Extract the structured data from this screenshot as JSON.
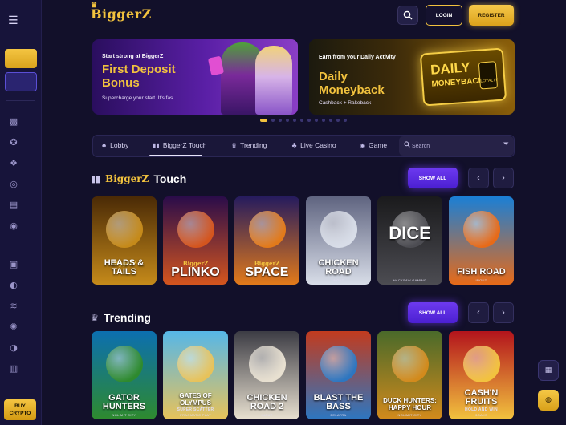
{
  "brand": {
    "logo_text": "BiggerZ"
  },
  "header": {
    "login_label": "LOGIN",
    "register_label": "REGISTER"
  },
  "sidebar": {
    "buy_crypto_line1": "BUY",
    "buy_crypto_line2": "CRYPTO",
    "icons": [
      "dice-icon",
      "bonus-icon",
      "puzzle-icon",
      "roulette-icon",
      "gift-card-icon",
      "chips-icon",
      "gift-icon",
      "coin-icon",
      "layers-icon",
      "medal-icon",
      "sport-icon",
      "receipt-icon"
    ]
  },
  "banners": [
    {
      "eyebrow": "Start strong at BiggerZ",
      "title": "First Deposit Bonus",
      "subtitle": "Supercharge your start. It's fas...",
      "accent": "#5a1fa6"
    },
    {
      "eyebrow": "Earn from your Daily Activity",
      "title": "Daily Moneyback",
      "subtitle": "Cashback + Rakeback",
      "sign_line1": "DAILY",
      "sign_line2": "MONEYBACK",
      "badge": "LOYALTY",
      "accent": "#8a5e0a"
    }
  ],
  "carousel": {
    "dot_count": 12,
    "active_index": 0
  },
  "tabs": [
    {
      "label": "Lobby",
      "icon": "lobby-icon"
    },
    {
      "label": "BiggerZ Touch",
      "icon": "touch-icon"
    },
    {
      "label": "Trending",
      "icon": "trending-icon"
    },
    {
      "label": "Live Casino",
      "icon": "live-casino-icon"
    },
    {
      "label": "Game",
      "icon": "game-icon"
    }
  ],
  "search": {
    "placeholder": "Search"
  },
  "sections": {
    "touch": {
      "logo": "BiggerZ",
      "title": "Touch",
      "show_all": "SHOW ALL"
    },
    "trending": {
      "title": "Trending",
      "show_all": "SHOW ALL"
    }
  },
  "touch_games": [
    {
      "name": "HEADS & TAILS",
      "brand": "BiggerZ",
      "provider": "",
      "colors": [
        "#4a2a06",
        "#c58a1a"
      ]
    },
    {
      "name": "PLINKO",
      "brand": "BiggerZ",
      "provider": "",
      "colors": [
        "#2a0c4a",
        "#d4551e"
      ]
    },
    {
      "name": "SPACE",
      "brand": "BiggerZ",
      "provider": "",
      "colors": [
        "#251b5e",
        "#e27a1a"
      ]
    },
    {
      "name": "CHICKEN ROAD",
      "brand": "",
      "provider": "INOUT",
      "colors": [
        "#5f6480",
        "#d8dde8"
      ]
    },
    {
      "name": "DICE",
      "brand": "",
      "provider": "HACKSAW GAMING",
      "colors": [
        "#1a1a1c",
        "#4c4c52"
      ]
    },
    {
      "name": "FISH ROAD",
      "brand": "",
      "provider": "INOUT",
      "colors": [
        "#1a7fd6",
        "#e76a18"
      ]
    }
  ],
  "trending_games": [
    {
      "name": "GATOR HUNTERS",
      "provider": "NOLIMIT CITY",
      "colors": [
        "#0c6fb0",
        "#2e8a2e"
      ]
    },
    {
      "name": "GATES OF OLYMPUS",
      "sub": "SUPER SCATTER",
      "provider": "PRAGMATIC PLAY",
      "colors": [
        "#56b7e8",
        "#e7c25a"
      ]
    },
    {
      "name": "CHICKEN ROAD 2",
      "provider": "INOUT",
      "colors": [
        "#3c3c44",
        "#e8e0d0"
      ]
    },
    {
      "name": "BLAST THE BASS",
      "provider": "BELATRA",
      "colors": [
        "#c23b1e",
        "#2d76c0"
      ]
    },
    {
      "name": "DUCK HUNTERS: HAPPY HOUR",
      "provider": "NOLIMIT CITY",
      "colors": [
        "#4a6a2a",
        "#d28a1c"
      ]
    },
    {
      "name": "CASH'N FRUITS",
      "sub": "HOLD AND WIN",
      "provider": "3OAKS",
      "colors": [
        "#b3141c",
        "#f2c23e"
      ]
    }
  ]
}
